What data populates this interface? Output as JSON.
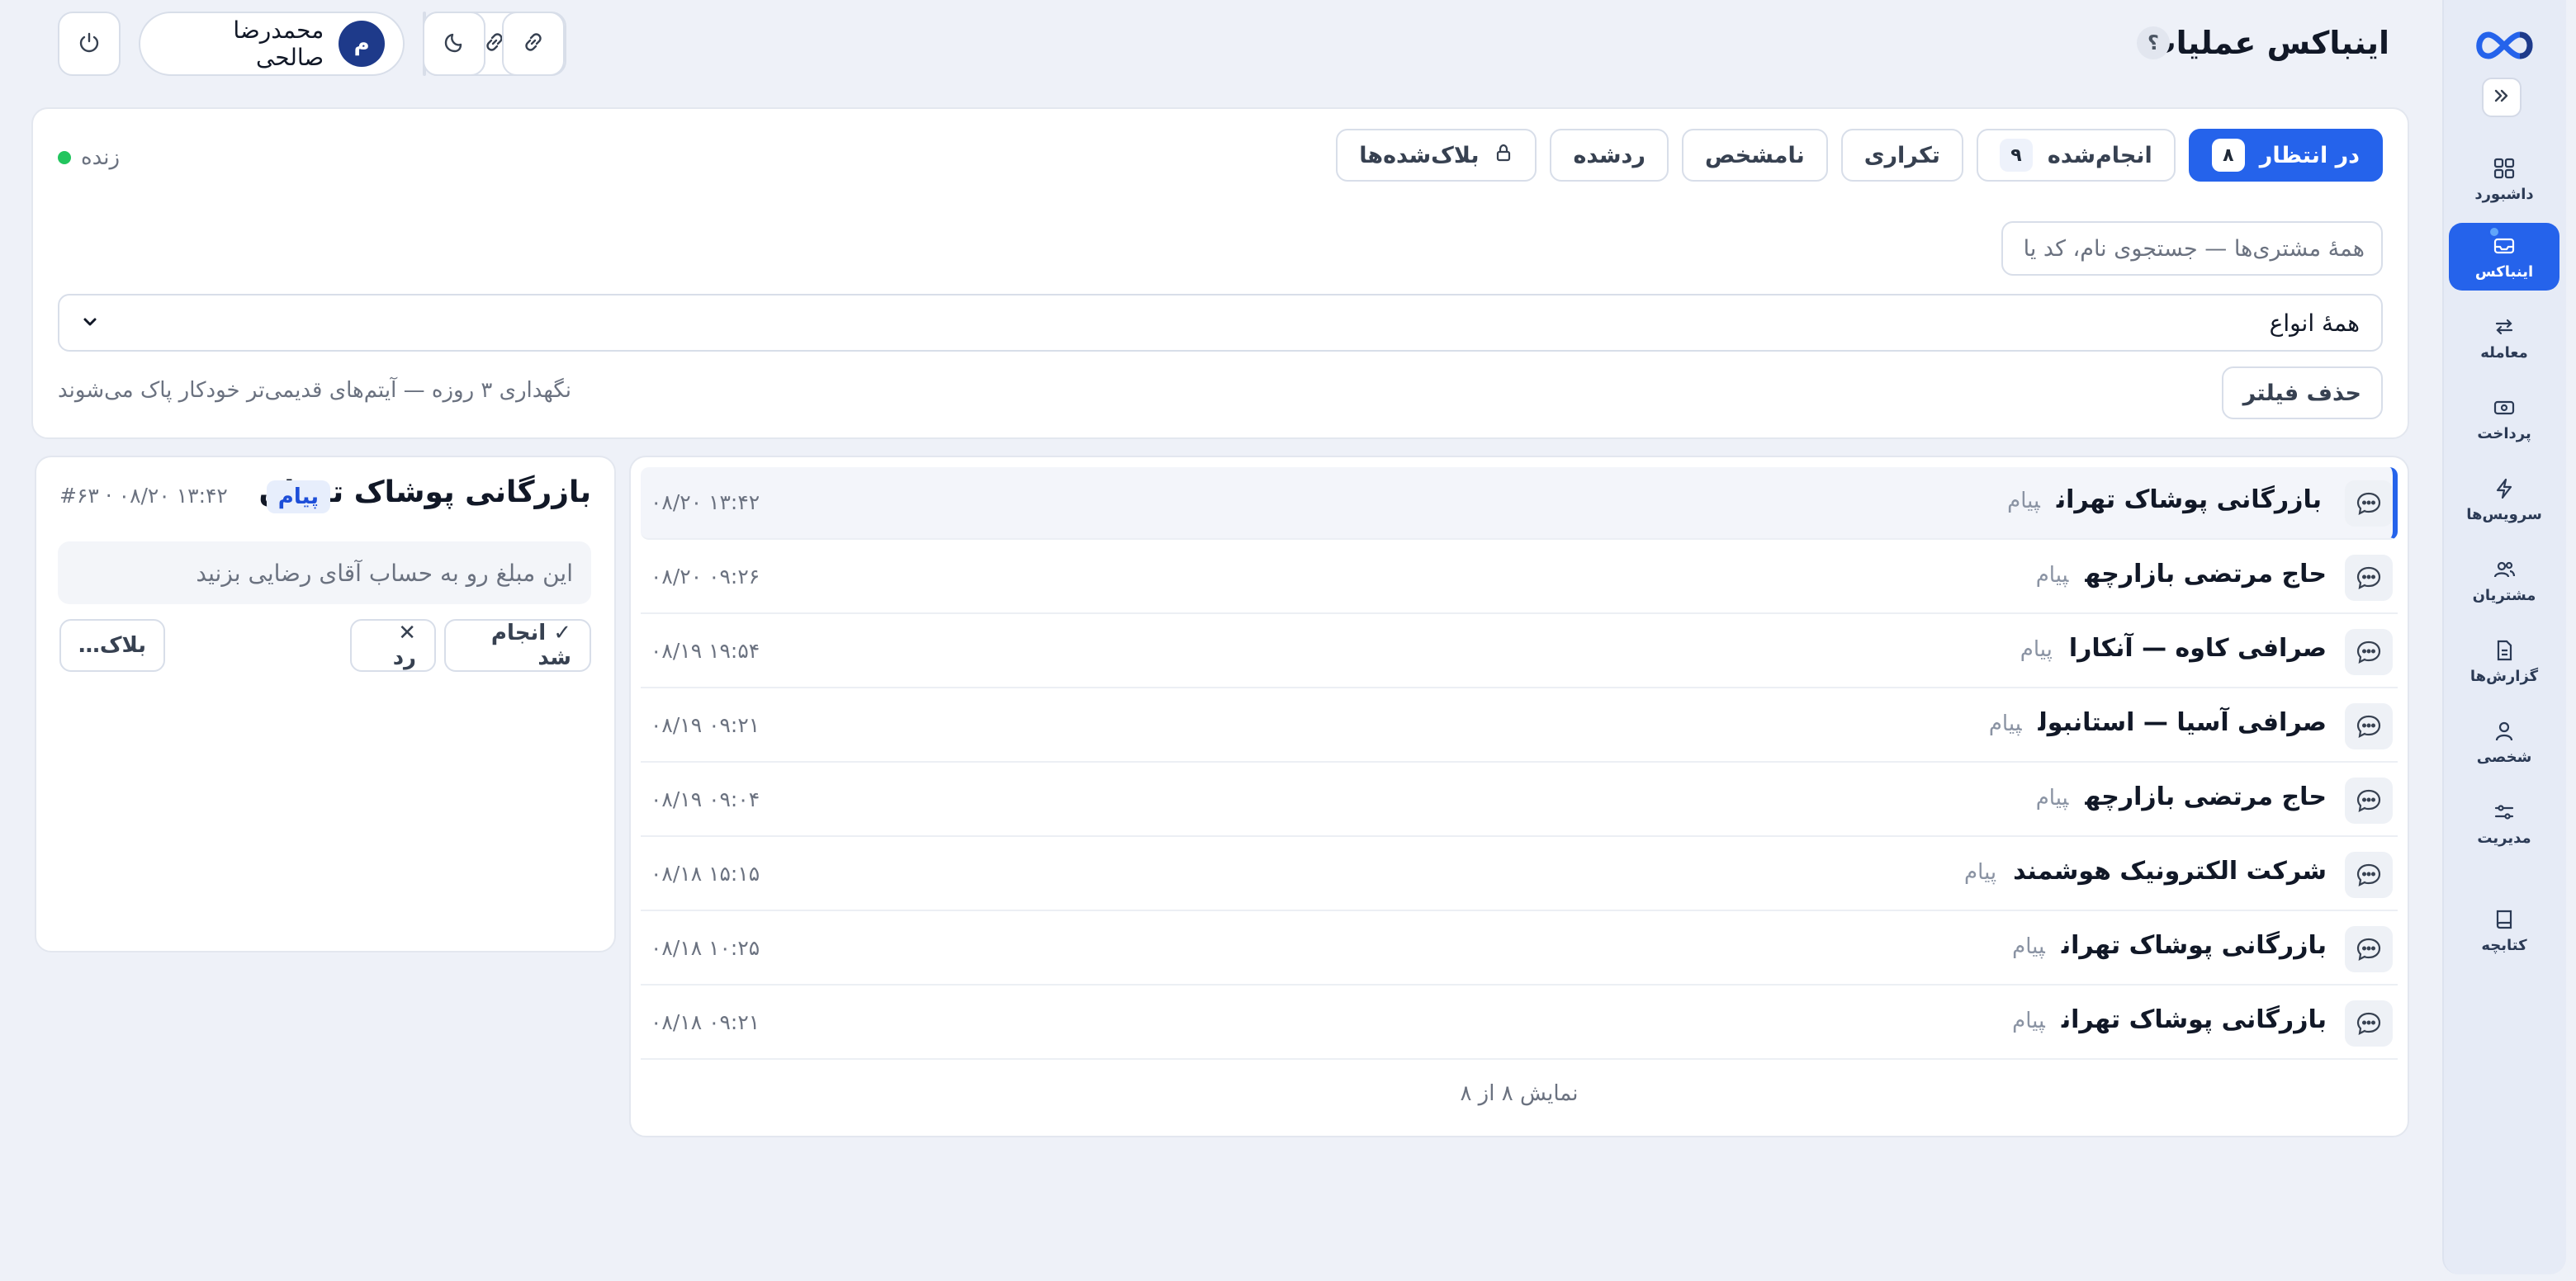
{
  "app": {
    "title": "اینباکس عملیات",
    "help_label": "؟"
  },
  "user": {
    "avatar_initial": "م",
    "name": "محمدرضا صالحی"
  },
  "sidebar": {
    "items": [
      {
        "label": "داشبورد",
        "icon": "grid-icon"
      },
      {
        "label": "اینباکس",
        "icon": "inbox-icon",
        "active": true
      },
      {
        "label": "معامله",
        "icon": "swap-icon"
      },
      {
        "label": "پرداخت",
        "icon": "cash-icon"
      },
      {
        "label": "سرویس‌ها",
        "icon": "bolt-icon"
      },
      {
        "label": "مشتریان",
        "icon": "users-icon"
      },
      {
        "label": "گزارش‌ها",
        "icon": "report-icon"
      },
      {
        "label": "شخصی",
        "icon": "person-icon"
      },
      {
        "label": "مدیریت",
        "icon": "sliders-icon"
      },
      {
        "label": "کتابچه",
        "icon": "book-icon"
      }
    ]
  },
  "tabs": [
    {
      "label": "در انتظار",
      "count": "۸",
      "active": true
    },
    {
      "label": "انجام‌شده",
      "count": "۹"
    },
    {
      "label": "تکراری"
    },
    {
      "label": "نامشخص"
    },
    {
      "label": "ردشده"
    },
    {
      "label": "بلاک‌شده‌ها",
      "icon": "lock-icon"
    }
  ],
  "status": {
    "live_label": "زنده"
  },
  "filters": {
    "search_placeholder": "همهٔ مشتری‌ها — جستجوی نام، کد یا",
    "type_value": "همهٔ انواع",
    "clear_label": "حذف فیلتر",
    "retention_note": "نگهداری ۳ روزه — آیتم‌های قدیمی‌تر خودکار پاک می‌شوند"
  },
  "list": {
    "rows": [
      {
        "title": "بازرگانی پوشاک تهران",
        "type": "پیام",
        "time": "۰۸/۲۰ ۱۳:۴۲",
        "selected": true
      },
      {
        "title": "حاج مرتضی بازارچه",
        "type": "پیام",
        "time": "۰۸/۲۰ ۰۹:۲۶"
      },
      {
        "title": "صرافی کاوه — آنکارا",
        "type": "پیام",
        "time": "۰۸/۱۹ ۱۹:۵۴"
      },
      {
        "title": "صرافی آسیا — استانبول",
        "type": "پیام",
        "time": "۰۸/۱۹ ۰۹:۲۱"
      },
      {
        "title": "حاج مرتضی بازارچه",
        "type": "پیام",
        "time": "۰۸/۱۹ ۰۹:۰۴"
      },
      {
        "title": "شرکت الکترونیک هوشمند",
        "type": "پیام",
        "time": "۰۸/۱۸ ۱۵:۱۵"
      },
      {
        "title": "بازرگانی پوشاک تهران",
        "type": "پیام",
        "time": "۰۸/۱۸ ۱۰:۲۵"
      },
      {
        "title": "بازرگانی پوشاک تهران",
        "type": "پیام",
        "time": "۰۸/۱۸ ۰۹:۲۱"
      }
    ],
    "footer": "نمایش ۸ از ۸"
  },
  "detail": {
    "title": "بازرگانی پوشاک تهران",
    "badge": "پیام",
    "meta": "#۶۳ · ۰۸/۲۰ ۱۳:۴۲",
    "message": "این مبلغ رو به حساب آقای رضایی بزنید",
    "done_label": "✓ انجام شد",
    "reject_label": "✕ رد",
    "block_label": "بلاک…"
  },
  "colors": {
    "accent": "#2563eb",
    "live": "#22c55e",
    "background": "#eef1f8"
  }
}
